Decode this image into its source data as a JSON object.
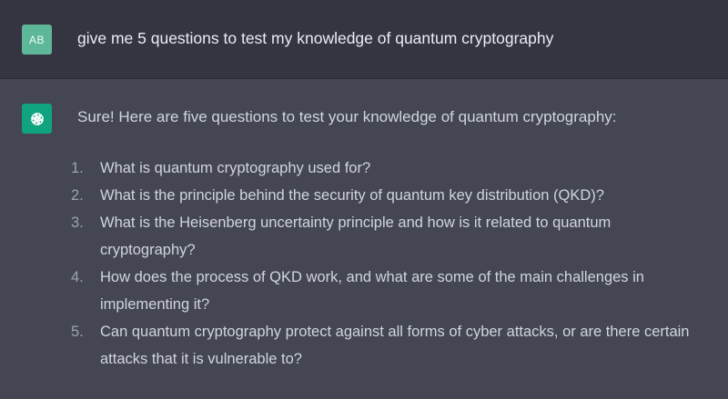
{
  "user": {
    "avatar_initials": "AB",
    "message": "give me 5 questions to test my knowledge of quantum cryptography"
  },
  "assistant": {
    "avatar_icon": "openai-logo-icon",
    "intro": "Sure! Here are five questions to test your knowledge of quantum cryptography:",
    "questions": [
      {
        "number": "1.",
        "text": "What is quantum cryptography used for?"
      },
      {
        "number": "2.",
        "text": "What is the principle behind the security of quantum key distribution (QKD)?"
      },
      {
        "number": "3.",
        "text": "What is the Heisenberg uncertainty principle and how is it related to quantum cryptography?"
      },
      {
        "number": "4.",
        "text": "How does the process of QKD work, and what are some of the main challenges in implementing it?"
      },
      {
        "number": "5.",
        "text": "Can quantum cryptography protect against all forms of cyber attacks, or are there certain attacks that it is vulnerable to?"
      }
    ]
  },
  "colors": {
    "user_background": "#343541",
    "assistant_background": "#444654",
    "user_avatar": "#5fb79a",
    "assistant_avatar": "#10a37f"
  }
}
